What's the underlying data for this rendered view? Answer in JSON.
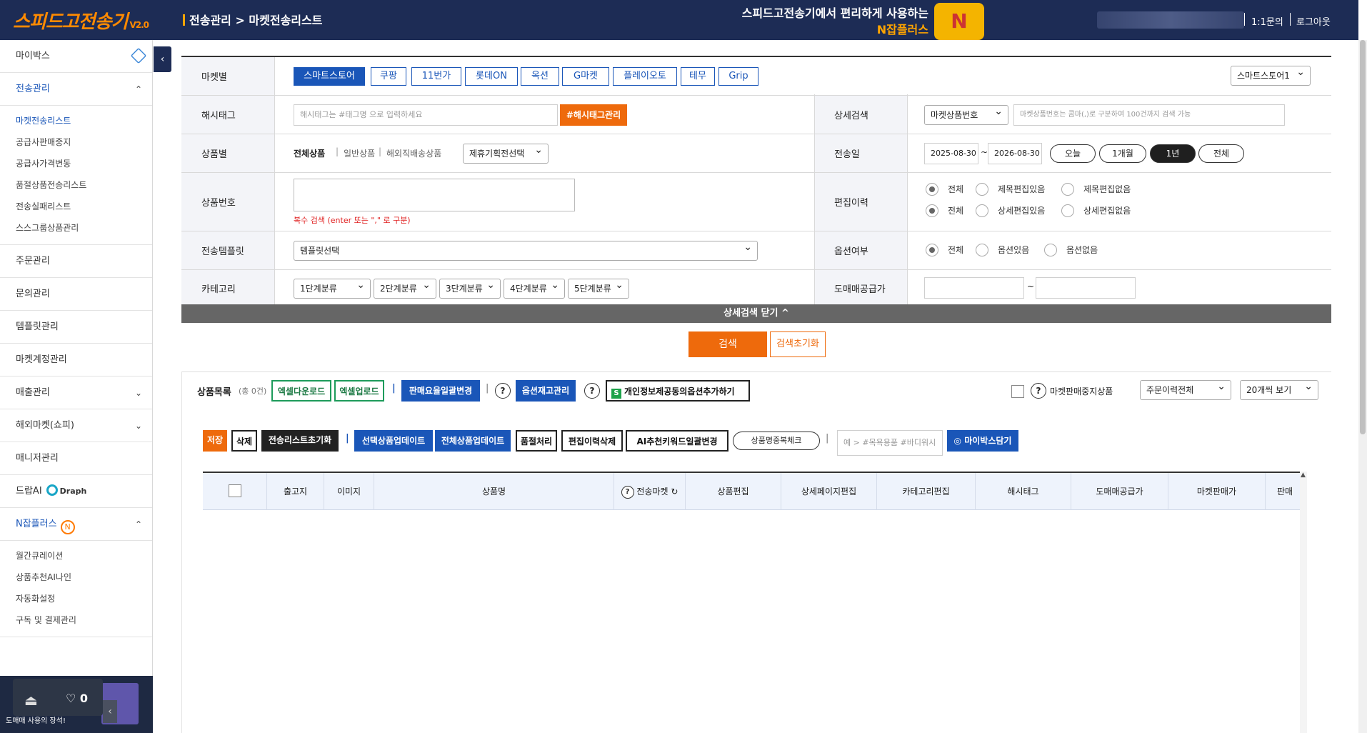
{
  "header": {
    "logo": "스피드고전송기",
    "logo_version": "V2.0",
    "breadcrumb": "전송관리 > 마켓전송리스트",
    "promo_line1": "스피드고전송기에서 편리하게 사용하는",
    "promo_line2": "N잡플러스",
    "inquiry": "1:1문의",
    "logout": "로그아웃"
  },
  "sidebar": {
    "mybox": "마이박스",
    "transfer_mgmt": "전송관리",
    "transfer_sub": [
      "마켓전송리스트",
      "공급사판매중지",
      "공급사가격변동",
      "품절상품전송리스트",
      "전송실패리스트",
      "스스그룹상품관리"
    ],
    "order_mgmt": "주문관리",
    "inquiry_mgmt": "문의관리",
    "template_mgmt": "템플릿관리",
    "market_account": "마켓계정관리",
    "sales_mgmt": "매출관리",
    "overseas": "해외마켓(쇼피)",
    "manager_mgmt": "매니저관리",
    "drop_ai": "드랍AI",
    "draph": "Draph",
    "njob": "N잡플러스",
    "njob_sub": [
      "월간큐레이션",
      "상품추천AI나인",
      "자동화설정",
      "구독 및 결제관리"
    ],
    "widget_heart": "0",
    "widget_text": "도매매 사용의 장석!"
  },
  "search": {
    "market_label": "마켓별",
    "markets": [
      "스마트스토어",
      "쿠팡",
      "11번가",
      "롯데ON",
      "옥션",
      "G마켓",
      "플레이오토",
      "테무",
      "Grip"
    ],
    "store_select": "스마트스토어1",
    "hashtag_label": "해시태그",
    "hashtag_placeholder": "해시태그는 #태그명 으로 입력하세요",
    "hashtag_btn": "#해시태그관리",
    "detail_label": "상세검색",
    "detail_select": "마켓상품번호",
    "detail_placeholder": "마켓상품번호는 콤마(,)로 구분하여 100건까지 검색 가능",
    "product_label": "상품별",
    "product_types": [
      "전체상품",
      "일반상품",
      "해외직배송상품"
    ],
    "promo_select": "제휴기획전선택",
    "sent_date_label": "전송일",
    "date_from": "2025-08-30",
    "date_to": "2026-08-30",
    "date_sep": "~",
    "date_pills": [
      "오늘",
      "1개월",
      "1년",
      "전체"
    ],
    "product_no_label": "상품번호",
    "product_no_hint": "복수 검색 (enter 또는 \",\" 로 구분)",
    "edit_history_label": "편집이력",
    "edit_row1": [
      "전체",
      "제목편집있음",
      "제목편집없음"
    ],
    "edit_row2": [
      "전체",
      "상세편집있음",
      "상세편집없음"
    ],
    "template_label": "전송템플릿",
    "template_select": "템플릿선택",
    "option_label": "옵션여부",
    "option_row": [
      "전체",
      "옵션있음",
      "옵션없음"
    ],
    "category_label": "카테고리",
    "categories": [
      "1단계분류",
      "2단계분류",
      "3단계분류",
      "4단계분류",
      "5단계분류"
    ],
    "wholesale_label": "도매매공급가",
    "wholesale_sep": "~",
    "close_detail": "상세검색 닫기 ^",
    "search_btn": "검색",
    "reset_btn": "검색초기화"
  },
  "list": {
    "title": "상품목록",
    "count": "(총 0건)",
    "excel_download": "엑셀다운로드",
    "excel_upload": "엑셀업로드",
    "rate_change": "판매요율일괄변경",
    "help": "?",
    "option_stock": "옵션재고관리",
    "privacy_option": "개인정보제공동의옵션추가하기",
    "privacy_icon": "S",
    "stop_sale": "마켓판매중지상품",
    "order_history": "주문이력전체",
    "page_size": "20개씩 보기",
    "save": "저장",
    "delete": "삭제",
    "reset_list": "전송리스트초기화",
    "update_selected": "선택상품업데이트",
    "update_all": "전체상품업데이트",
    "soldout": "품절처리",
    "delete_history": "편집이력삭제",
    "ai_keyword": "AI추천키워드일괄변경",
    "dup_check": "상품명중복체크",
    "tag_placeholder": "예 > #목욕용품 #바디워시",
    "mybox_load": "◎ 마이박스담기"
  },
  "table": {
    "columns": [
      "출고지",
      "이미지",
      "상품명",
      "전송마켓",
      "상품편집",
      "상세페이지편집",
      "카테고리편집",
      "해시태그",
      "도매매공급가",
      "마켓판매가",
      "판매가"
    ]
  },
  "colors": {
    "navy": "#1d2c55",
    "accent_orange": "#ee6a0c",
    "primary_blue": "#1a56b8",
    "green": "#1d9b5b"
  }
}
